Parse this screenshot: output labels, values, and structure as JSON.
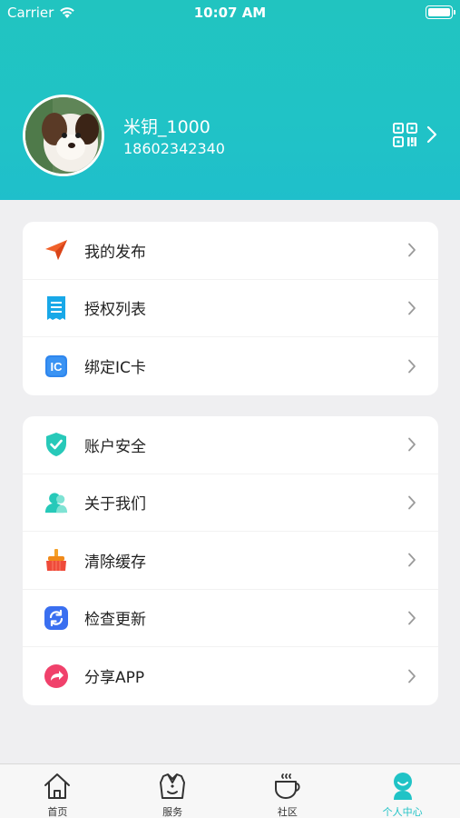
{
  "status_bar": {
    "carrier": "Carrier",
    "time": "10:07 AM",
    "battery_level": 1.0
  },
  "profile": {
    "username": "米钥_1000",
    "phone": "18602342340"
  },
  "colors": {
    "accent": "#20c3c6",
    "header_gradient": [
      "#21c4c0",
      "#1fbfcb"
    ]
  },
  "menu_group_1": [
    {
      "label": "我的发布",
      "icon": "paper-plane-icon"
    },
    {
      "label": "授权列表",
      "icon": "document-list-icon"
    },
    {
      "label": "绑定IC卡",
      "icon": "ic-card-icon"
    }
  ],
  "menu_group_2": [
    {
      "label": "账户安全",
      "icon": "shield-check-icon"
    },
    {
      "label": "关于我们",
      "icon": "people-icon"
    },
    {
      "label": "清除缓存",
      "icon": "broom-icon"
    },
    {
      "label": "检查更新",
      "icon": "refresh-icon"
    },
    {
      "label": "分享APP",
      "icon": "share-icon"
    }
  ],
  "tabbar": [
    {
      "label": "首页",
      "icon": "home-icon"
    },
    {
      "label": "服务",
      "icon": "service-icon"
    },
    {
      "label": "社区",
      "icon": "coffee-cup-icon"
    },
    {
      "label": "个人中心",
      "icon": "person-icon",
      "active": true
    }
  ]
}
